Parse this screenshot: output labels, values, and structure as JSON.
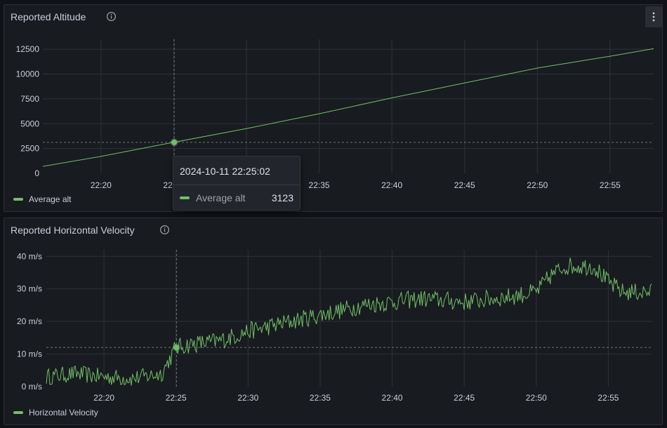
{
  "colors": {
    "series": "#73bf69",
    "background": "#181b1f",
    "grid": "#2f3237"
  },
  "panels": [
    {
      "title": "Reported Altitude",
      "info_icon": "info-circle-icon",
      "menu_icon": "more-vertical-icon",
      "legend": [
        "Average alt"
      ]
    },
    {
      "title": "Reported Horizontal Velocity",
      "info_icon": "info-circle-icon",
      "legend": [
        "Horizontal Velocity"
      ]
    }
  ],
  "tooltip": {
    "time": "2024-10-11 22:25:02",
    "series": "Average alt",
    "value": "3123"
  },
  "chart_data": [
    {
      "type": "line",
      "title": "Reported Altitude",
      "x_label": "time",
      "x_range": [
        "22:16:00",
        "22:58:00"
      ],
      "x_ticks": [
        "22:20",
        "22:25",
        "22:30",
        "22:35",
        "22:40",
        "22:45",
        "22:50",
        "22:55"
      ],
      "y_ticks": [
        "0",
        "2500",
        "5000",
        "7500",
        "10000",
        "12500"
      ],
      "ylim": [
        0,
        13500
      ],
      "grid": true,
      "legend_position": "bottom-left",
      "series": [
        {
          "name": "Average alt",
          "x": [
            "22:16",
            "22:20",
            "22:25",
            "22:30",
            "22:35",
            "22:40",
            "22:45",
            "22:50",
            "22:55",
            "22:58"
          ],
          "values": [
            700,
            1700,
            3123,
            4500,
            6000,
            7600,
            9100,
            10600,
            11800,
            12550
          ]
        }
      ],
      "hover": {
        "x": "22:25:02",
        "value": 3123
      }
    },
    {
      "type": "line",
      "title": "Reported Horizontal Velocity",
      "x_label": "time",
      "x_range": [
        "22:16:00",
        "22:58:00"
      ],
      "x_ticks": [
        "22:20",
        "22:25",
        "22:30",
        "22:35",
        "22:40",
        "22:45",
        "22:50",
        "22:55"
      ],
      "y_ticks": [
        "0 m/s",
        "10 m/s",
        "20 m/s",
        "30 m/s",
        "40 m/s"
      ],
      "ylim": [
        0,
        42
      ],
      "grid": true,
      "legend_position": "bottom-left",
      "series": [
        {
          "name": "Horizontal Velocity",
          "x": [
            "22:16",
            "22:18",
            "22:20",
            "22:22",
            "22:24",
            "22:25",
            "22:26",
            "22:28",
            "22:30",
            "22:32",
            "22:35",
            "22:38",
            "22:40",
            "22:42",
            "22:45",
            "22:48",
            "22:50",
            "22:51",
            "22:52",
            "22:54",
            "22:55",
            "22:56",
            "22:58"
          ],
          "values": [
            3,
            4,
            3,
            2.5,
            4,
            12,
            13,
            14,
            17,
            19,
            22,
            25,
            26,
            27,
            26,
            27.5,
            29,
            34,
            37,
            37,
            32,
            29,
            29
          ]
        }
      ],
      "hover": {
        "x": "22:25:02",
        "value": 12
      }
    }
  ]
}
